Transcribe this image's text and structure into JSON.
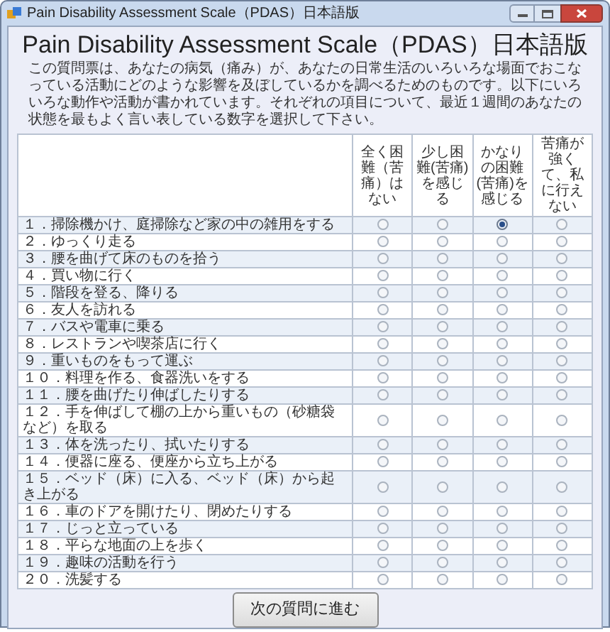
{
  "window": {
    "title": "Pain Disability Assessment Scale（PDAS）日本語版"
  },
  "heading": "Pain Disability Assessment Scale（PDAS）日本語版",
  "instructions": "この質問票は、あなたの病気（痛み）が、あなたの日常生活のいろいろな場面でおこなっている活動にどのような影響を及ぼしているかを調べるためのものです。以下にいろいろな動作や活動が書かれています。それぞれの項目について、最近１週間のあなたの状態を最もよく言い表している数字を選択して下さい。",
  "columns": [
    "全く困難（苦痛）はない",
    "少し困難(苦痛)を感じる",
    "かなりの困難(苦痛)を感じる",
    "苦痛が強くて、私に行えない"
  ],
  "rows": [
    {
      "label": "１．掃除機かけ、庭掃除など家の中の雑用をする",
      "options": [
        {
          "selected": false
        },
        {
          "selected": false
        },
        {
          "selected": true
        },
        {
          "selected": false
        }
      ]
    },
    {
      "label": "２．ゆっくり走る",
      "options": [
        {
          "selected": false
        },
        {
          "selected": false
        },
        {
          "selected": false
        },
        {
          "selected": false
        }
      ]
    },
    {
      "label": "３．腰を曲げて床のものを拾う",
      "options": [
        {
          "selected": false
        },
        {
          "selected": false
        },
        {
          "selected": false
        },
        {
          "selected": false
        }
      ]
    },
    {
      "label": "４．買い物に行く",
      "options": [
        {
          "selected": false
        },
        {
          "selected": false
        },
        {
          "selected": false
        },
        {
          "selected": false
        }
      ]
    },
    {
      "label": "５．階段を登る、降りる",
      "options": [
        {
          "selected": false
        },
        {
          "selected": false
        },
        {
          "selected": false
        },
        {
          "selected": false
        }
      ]
    },
    {
      "label": "６．友人を訪れる",
      "options": [
        {
          "selected": false
        },
        {
          "selected": false
        },
        {
          "selected": false
        },
        {
          "selected": false
        }
      ]
    },
    {
      "label": "７．バスや電車に乗る",
      "options": [
        {
          "selected": false
        },
        {
          "selected": false
        },
        {
          "selected": false
        },
        {
          "selected": false
        }
      ]
    },
    {
      "label": "８．レストランや喫茶店に行く",
      "options": [
        {
          "selected": false
        },
        {
          "selected": false
        },
        {
          "selected": false
        },
        {
          "selected": false
        }
      ]
    },
    {
      "label": "９．重いものをもって運ぶ",
      "options": [
        {
          "selected": false
        },
        {
          "selected": false
        },
        {
          "selected": false
        },
        {
          "selected": false
        }
      ]
    },
    {
      "label": "１０．料理を作る、食器洗いをする",
      "options": [
        {
          "selected": false
        },
        {
          "selected": false
        },
        {
          "selected": false
        },
        {
          "selected": false
        }
      ]
    },
    {
      "label": "１１．腰を曲げたり伸ばしたりする",
      "options": [
        {
          "selected": false
        },
        {
          "selected": false
        },
        {
          "selected": false
        },
        {
          "selected": false
        }
      ]
    },
    {
      "label": "１２．手を伸ばして棚の上から重いもの（砂糖袋など）を取る",
      "options": [
        {
          "selected": false
        },
        {
          "selected": false
        },
        {
          "selected": false
        },
        {
          "selected": false
        }
      ]
    },
    {
      "label": "１３．体を洗ったり、拭いたりする",
      "options": [
        {
          "selected": false
        },
        {
          "selected": false
        },
        {
          "selected": false
        },
        {
          "selected": false
        }
      ]
    },
    {
      "label": "１４．便器に座る、便座から立ち上がる",
      "options": [
        {
          "selected": false
        },
        {
          "selected": false
        },
        {
          "selected": false
        },
        {
          "selected": false
        }
      ]
    },
    {
      "label": "１５．ベッド（床）に入る、ベッド（床）から起き上がる",
      "options": [
        {
          "selected": false
        },
        {
          "selected": false
        },
        {
          "selected": false
        },
        {
          "selected": false
        }
      ]
    },
    {
      "label": "１６．車のドアを開けたり、閉めたりする",
      "options": [
        {
          "selected": false
        },
        {
          "selected": false
        },
        {
          "selected": false
        },
        {
          "selected": false
        }
      ]
    },
    {
      "label": "１７．じっと立っている",
      "options": [
        {
          "selected": false
        },
        {
          "selected": false
        },
        {
          "selected": false
        },
        {
          "selected": false
        }
      ]
    },
    {
      "label": "１８．平らな地面の上を歩く",
      "options": [
        {
          "selected": false
        },
        {
          "selected": false
        },
        {
          "selected": false
        },
        {
          "selected": false
        }
      ]
    },
    {
      "label": "１９．趣味の活動を行う",
      "options": [
        {
          "selected": false
        },
        {
          "selected": false
        },
        {
          "selected": false
        },
        {
          "selected": false
        }
      ]
    },
    {
      "label": "２０．洗髪する",
      "options": [
        {
          "selected": false
        },
        {
          "selected": false
        },
        {
          "selected": false
        },
        {
          "selected": false
        }
      ]
    }
  ],
  "buttons": [
    "次の質問に進む"
  ]
}
